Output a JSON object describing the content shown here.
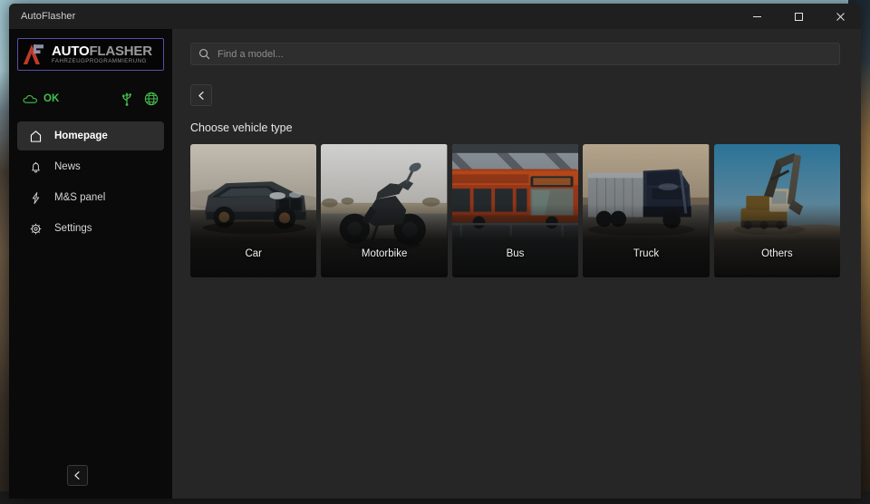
{
  "window": {
    "title": "AutoFlasher",
    "controls": [
      {
        "name": "minimize",
        "glyph": "─"
      },
      {
        "name": "maximize",
        "glyph": "□"
      },
      {
        "name": "close",
        "glyph": "✕"
      }
    ]
  },
  "sidebar": {
    "logo": {
      "icon_name": "autoflasher-logo-mark",
      "text_bold": "AUTO",
      "text_light": "FLASHER",
      "tagline": "FAHRZEUGPROGRAMMIERUNG",
      "border_color": "#5a4fa8",
      "mark_color": "#c0392b"
    },
    "status": {
      "icon_name": "cloud-icon",
      "text": "OK",
      "color": "#43c04a",
      "indicators": [
        {
          "name": "usb-icon",
          "title": "USB"
        },
        {
          "name": "globe-icon",
          "title": "Network"
        }
      ]
    },
    "items": [
      {
        "label": "Homepage",
        "icon": "home-icon",
        "active": true
      },
      {
        "label": "News",
        "icon": "bell-icon",
        "active": false
      },
      {
        "label": "M&S panel",
        "icon": "lightning-icon",
        "active": false
      },
      {
        "label": "Settings",
        "icon": "gear-icon",
        "active": false
      }
    ],
    "collapse": {
      "icon": "chevron-left-icon",
      "label": "Collapse sidebar"
    }
  },
  "main": {
    "search": {
      "icon": "search-icon",
      "placeholder": "Find a model...",
      "value": ""
    },
    "back_button": {
      "icon": "chevron-left-icon",
      "label": "Back"
    },
    "section_title": "Choose vehicle type",
    "vehicle_types": [
      {
        "label": "Car",
        "art": "car"
      },
      {
        "label": "Motorbike",
        "art": "motorbike"
      },
      {
        "label": "Bus",
        "art": "bus"
      },
      {
        "label": "Truck",
        "art": "truck"
      },
      {
        "label": "Others",
        "art": "excavator"
      }
    ]
  }
}
